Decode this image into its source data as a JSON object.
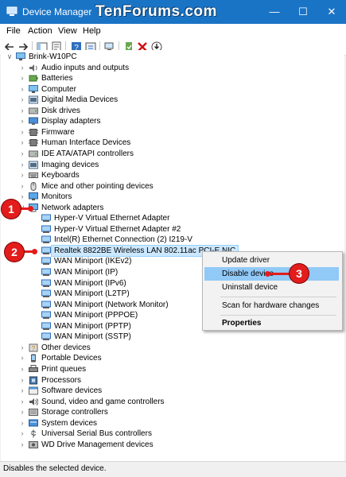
{
  "window": {
    "title": "Device Manager",
    "watermark": "TenForums.com",
    "controls": [
      "minimize-icon",
      "maximize-icon",
      "close-icon"
    ]
  },
  "menu": [
    "File",
    "Action",
    "View",
    "Help"
  ],
  "toolbar": [
    "back-icon",
    "forward-icon",
    "show-hide-icon",
    "properties-icon",
    "help-icon",
    "update-driver-icon",
    "scan-icon",
    "enable-icon",
    "uninstall-icon",
    "disable-icon"
  ],
  "tree": {
    "root": "Brink-W10PC",
    "categories_top": [
      "Audio inputs and outputs",
      "Batteries",
      "Computer",
      "Digital Media Devices",
      "Disk drives",
      "Display adapters",
      "Firmware",
      "Human Interface Devices",
      "IDE ATA/ATAPI controllers",
      "Imaging devices",
      "Keyboards",
      "Mice and other pointing devices",
      "Monitors"
    ],
    "expanded": "Network adapters",
    "network_children": [
      "Hyper-V Virtual Ethernet Adapter",
      "Hyper-V Virtual Ethernet Adapter #2",
      "Intel(R) Ethernet Connection (2) I219-V",
      "Realtek 8822BE Wireless LAN 802.11ac PCI-E NIC",
      "WAN Miniport (IKEv2)",
      "WAN Miniport (IP)",
      "WAN Miniport (IPv6)",
      "WAN Miniport (L2TP)",
      "WAN Miniport (Network Monitor)",
      "WAN Miniport (PPPOE)",
      "WAN Miniport (PPTP)",
      "WAN Miniport (SSTP)"
    ],
    "selected_child": "Realtek 8822BE Wireless LAN 802.11ac PCI-E NIC",
    "categories_bottom": [
      "Other devices",
      "Portable Devices",
      "Print queues",
      "Processors",
      "Software devices",
      "Sound, video and game controllers",
      "Storage controllers",
      "System devices",
      "Universal Serial Bus controllers",
      "WD Drive Management devices"
    ]
  },
  "context_menu": [
    "Update driver",
    "Disable device",
    "Uninstall device",
    "Scan for hardware changes",
    "Properties"
  ],
  "context_highlighted": "Disable device",
  "callouts": [
    "1",
    "2",
    "3"
  ],
  "status": "Disables the selected device.",
  "colors": {
    "titlebar": "#1a74c6",
    "selection": "#cce8ff",
    "menu_highlight": "#91c9f7",
    "callout": "#e31c1c"
  }
}
